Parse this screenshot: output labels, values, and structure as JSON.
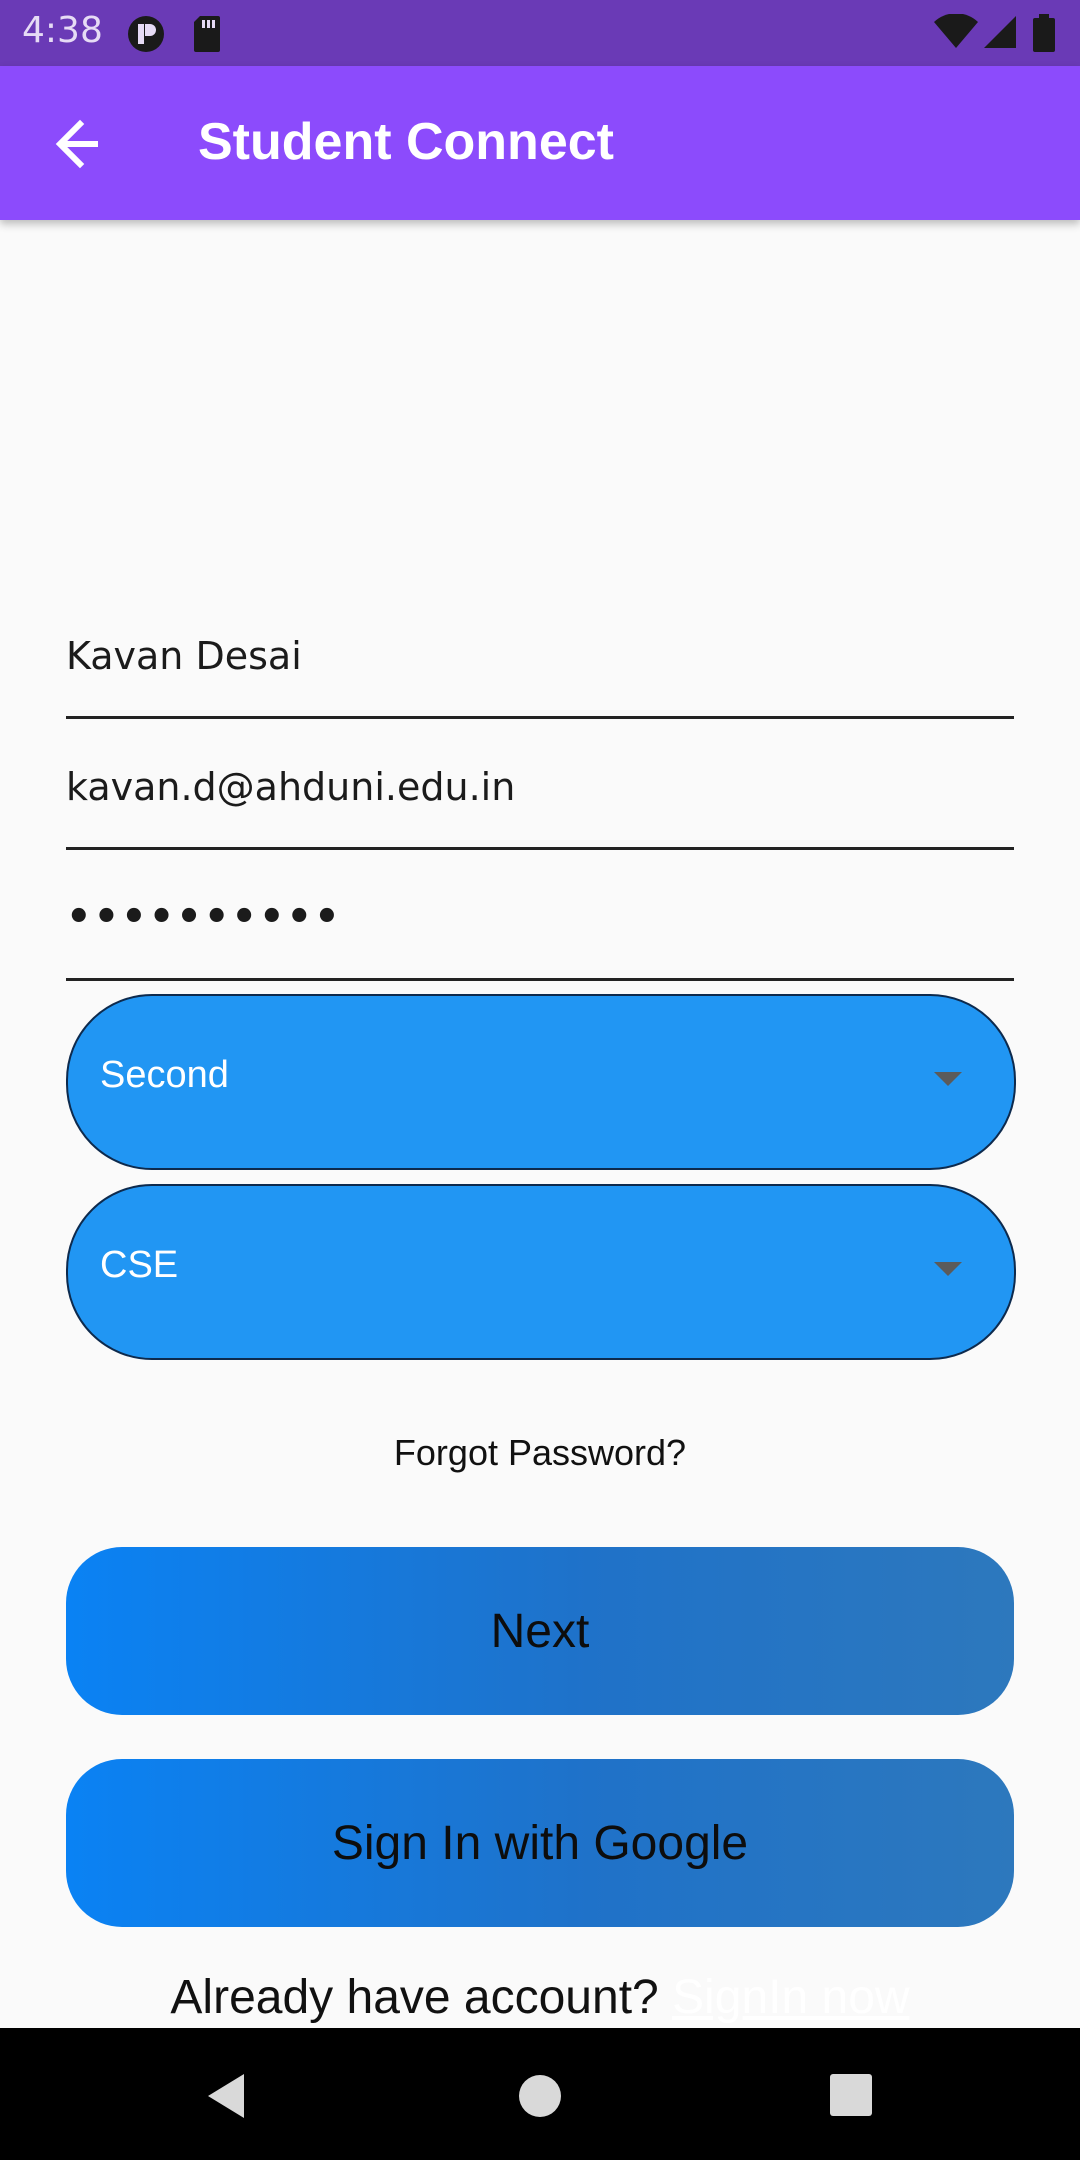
{
  "status_bar": {
    "time": "4:38",
    "icons": [
      "pocket-casts-icon",
      "sd-card-icon",
      "wifi-icon",
      "signal-icon",
      "battery-icon"
    ]
  },
  "app_bar": {
    "title": "Student Connect",
    "back_icon": "arrow-left-icon"
  },
  "form": {
    "name_value": "Kavan Desai",
    "email_value": "kavan.d@ahduni.edu.in",
    "password_value": "••••••••••",
    "year_dropdown": "Second",
    "branch_dropdown": "CSE",
    "forgot_password": "Forgot Password?",
    "next_button": "Next",
    "google_button": "Sign In with Google",
    "already_text": "Already have account?",
    "signin_link": "SignIn now"
  },
  "nav_bar": {
    "icons": [
      "back-triangle-icon",
      "home-circle-icon",
      "recents-square-icon"
    ]
  },
  "colors": {
    "status_bar": "#6a3ab6",
    "app_bar": "#8c4bfc",
    "dropdown": "#2196f3",
    "button_start": "#0a82f4",
    "button_end": "#2d78bd"
  }
}
